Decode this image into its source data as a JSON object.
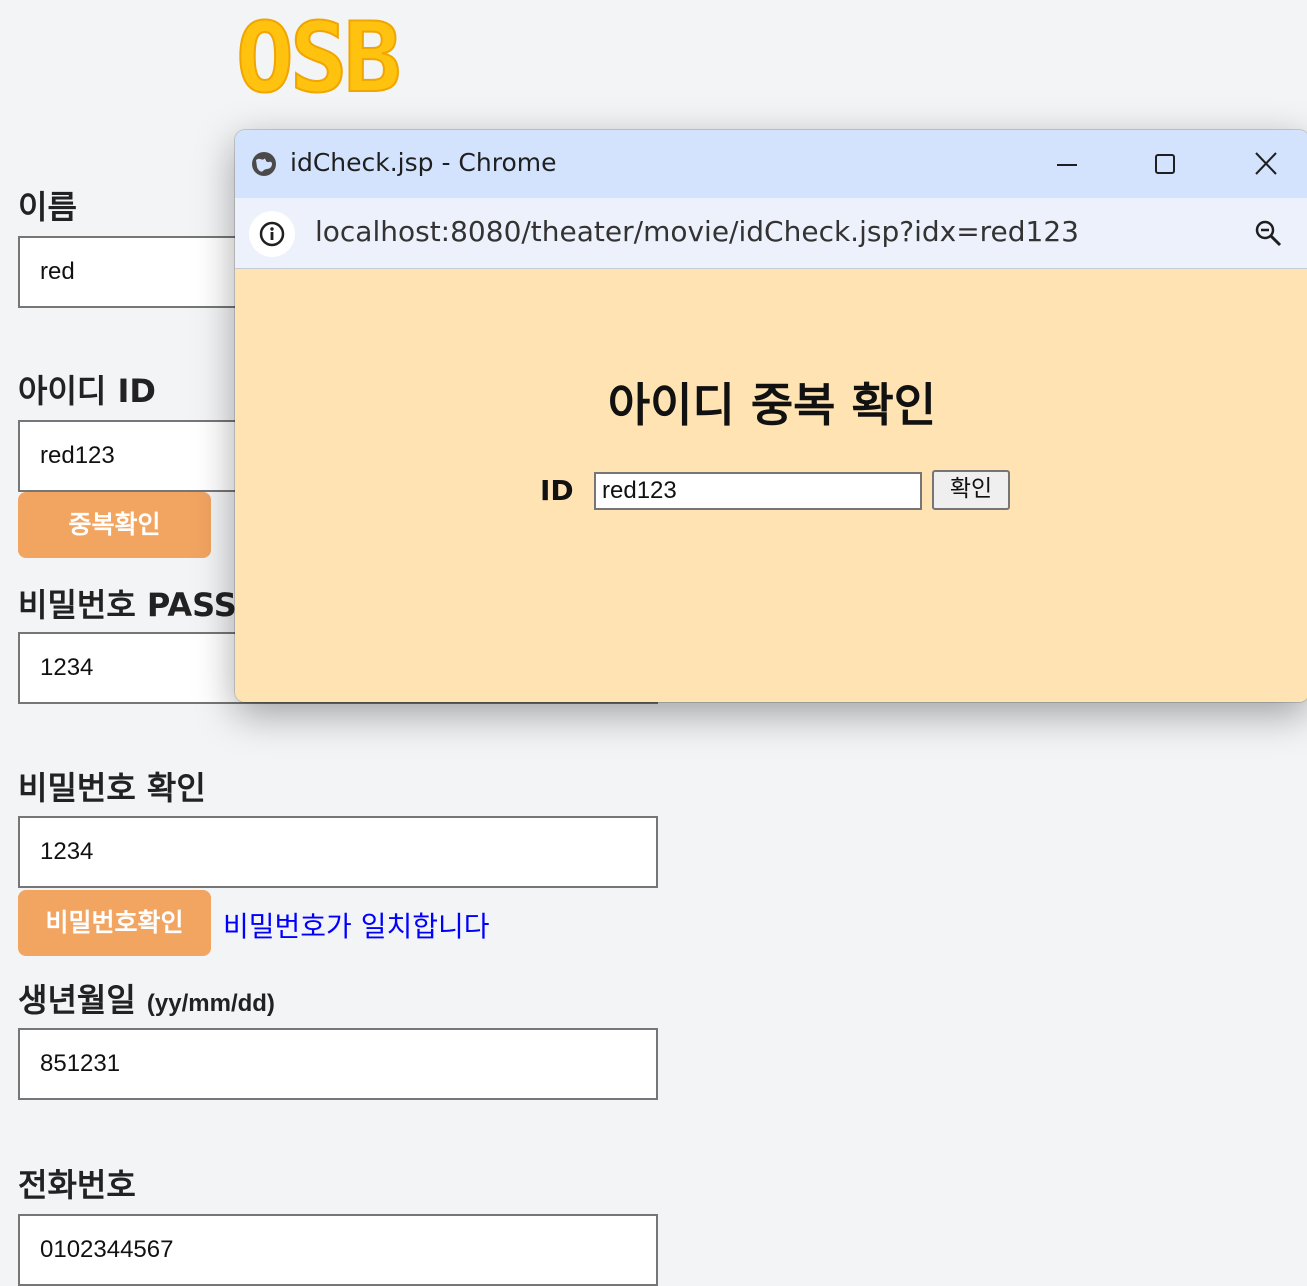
{
  "logo": {
    "text": "OSB",
    "color": "#ffc20e"
  },
  "form": {
    "name": {
      "label": "이름",
      "value": "red"
    },
    "id": {
      "label": "아이디 ID",
      "value": "red123",
      "check_button": "중복확인"
    },
    "password": {
      "label": "비밀번호 PASS",
      "value": "1234"
    },
    "password_confirm": {
      "label": "비밀번호 확인",
      "value": "1234",
      "check_button": "비밀번호확인",
      "message": "비밀번호가 일치합니다"
    },
    "birth": {
      "label": "생년월일",
      "label_sub": "(yy/mm/dd)",
      "value": "851231"
    },
    "phone": {
      "label": "전화번호",
      "value": "0102344567"
    }
  },
  "popup": {
    "window_title": "idCheck.jsp - Chrome",
    "url": "localhost:8080/theater/movie/idCheck.jsp?idx=red123",
    "heading": "아이디 중복 확인",
    "id_label": "ID",
    "id_value": "red123",
    "confirm_button": "확인",
    "icons": {
      "globe": "globe-icon",
      "minimize": "minimize-icon",
      "maximize": "maximize-icon",
      "close": "close-icon",
      "info": "info-icon",
      "zoom": "zoom-icon"
    },
    "colors": {
      "titlebar": "#d3e3fd",
      "content": "#ffe3b3"
    }
  },
  "colors": {
    "accent_button": "#f2a461",
    "match_message": "#0000ff"
  }
}
